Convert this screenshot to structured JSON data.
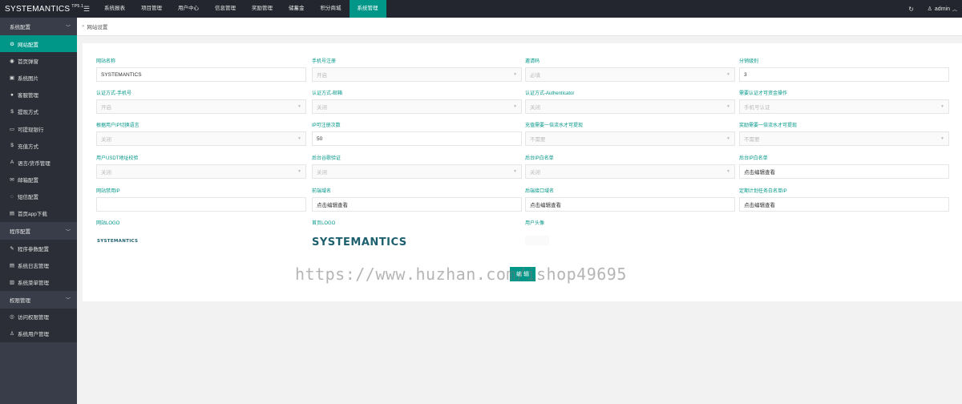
{
  "header": {
    "logo": "SYSTEMANTICS",
    "version": "TP5.1",
    "menu_icon": "☰",
    "nav": [
      "系统报表",
      "项目管理",
      "用户中心",
      "信息管理",
      "奖励管理",
      "储蓄金",
      "积分商城",
      "系统管理"
    ],
    "active_nav_index": 7,
    "refresh_icon": "↻",
    "user_name": "admin"
  },
  "sidebar": {
    "group1": "系统配置",
    "group1_items": [
      {
        "icon": "⚙",
        "label": "网站配置"
      },
      {
        "icon": "◉",
        "label": "首页弹窗"
      },
      {
        "icon": "▣",
        "label": "系统图片"
      },
      {
        "icon": "●",
        "label": "客服管理"
      },
      {
        "icon": "$",
        "label": "提现方式"
      },
      {
        "icon": "▭",
        "label": "可提现银行"
      },
      {
        "icon": "$",
        "label": "充值方式"
      },
      {
        "icon": "A",
        "label": "语言/货币管理"
      },
      {
        "icon": "✉",
        "label": "邮箱配置"
      },
      {
        "icon": "◌",
        "label": "短信配置"
      },
      {
        "icon": "▤",
        "label": "首页app下载"
      }
    ],
    "group2": "程序配置",
    "group2_items": [
      {
        "icon": "✎",
        "label": "程序参数配置"
      },
      {
        "icon": "▤",
        "label": "系统日志管理"
      },
      {
        "icon": "▥",
        "label": "系统菜单管理"
      }
    ],
    "group3": "权限管理",
    "group3_items": [
      {
        "icon": "◎",
        "label": "访问权限管理"
      },
      {
        "icon": "♙",
        "label": "系统用户管理"
      }
    ]
  },
  "breadcrumb": {
    "arrows": "»",
    "label": "网站设置"
  },
  "form": {
    "row1": [
      {
        "label": "网站名称",
        "value": "SYSTEMANTICS",
        "type": "input"
      },
      {
        "label": "手机号注册",
        "value": "开启",
        "type": "select"
      },
      {
        "label": "邀请码",
        "value": "必填",
        "type": "select"
      },
      {
        "label": "分销级别",
        "value": "3",
        "type": "input"
      }
    ],
    "row2": [
      {
        "label": "认证方式-手机号",
        "value": "开启",
        "type": "select"
      },
      {
        "label": "认证方式-邮箱",
        "value": "关闭",
        "type": "select"
      },
      {
        "label": "认证方式-Authenticator",
        "value": "关闭",
        "type": "select"
      },
      {
        "label": "需要认证才可资金操作",
        "value": "手机号认证",
        "type": "select"
      }
    ],
    "row3": [
      {
        "label": "根据用户IP切换语言",
        "value": "关闭",
        "type": "select"
      },
      {
        "label": "IP可注册次数",
        "value": "50",
        "type": "input"
      },
      {
        "label": "充值需要一倍流水才可提现",
        "value": "不需要",
        "type": "select"
      },
      {
        "label": "奖励需要一倍流水才可提现",
        "value": "不需要",
        "type": "select"
      }
    ],
    "row4": [
      {
        "label": "用户USDT地址校验",
        "value": "关闭",
        "type": "select"
      },
      {
        "label": "后台谷歌验证",
        "value": "关闭",
        "type": "select"
      },
      {
        "label": "后台IP白名单",
        "value": "关闭",
        "type": "select"
      },
      {
        "label": "后台IP白名单",
        "value": "点击编辑查看",
        "type": "input"
      }
    ],
    "row5": [
      {
        "label": "网站禁用IP",
        "value": "",
        "type": "input"
      },
      {
        "label": "前端域名",
        "value": "点击编辑查看",
        "type": "input"
      },
      {
        "label": "后端接口域名",
        "value": "点击编辑查看",
        "type": "input"
      },
      {
        "label": "定期计划任务白名单IP",
        "value": "点击编辑查看",
        "type": "input"
      }
    ],
    "logos": {
      "site_logo_label": "网站LOGO",
      "site_logo_text": "SYSTEMANTICS",
      "home_logo_label": "首页LOGO",
      "home_logo_text": "SYSTEMANTICS",
      "avatar_label": "用户头像"
    },
    "submit_label": "编 辑"
  },
  "watermark": "https://www.huzhan.com/ishop49695"
}
